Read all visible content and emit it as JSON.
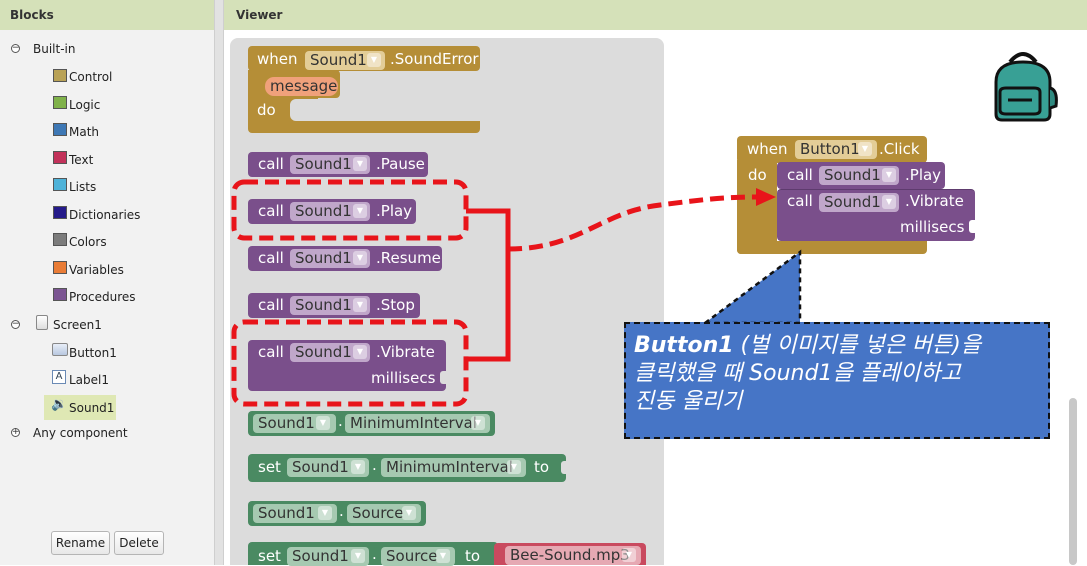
{
  "blocks_panel": {
    "title": "Blocks",
    "builtin_label": "Built-in",
    "builtin_items": [
      {
        "label": "Control",
        "color": "#b9a256"
      },
      {
        "label": "Logic",
        "color": "#80b24a"
      },
      {
        "label": "Math",
        "color": "#3e78b5"
      },
      {
        "label": "Text",
        "color": "#c2325a"
      },
      {
        "label": "Lists",
        "color": "#4eb2d8"
      },
      {
        "label": "Dictionaries",
        "color": "#251b8a"
      },
      {
        "label": "Colors",
        "color": "#7c7c7c"
      },
      {
        "label": "Variables",
        "color": "#e97c36"
      },
      {
        "label": "Procedures",
        "color": "#7b5592"
      }
    ],
    "screen_label": "Screen1",
    "components": [
      {
        "label": "Button1",
        "icon": "button-icon"
      },
      {
        "label": "Label1",
        "icon": "label-icon"
      },
      {
        "label": "Sound1",
        "icon": "sound-icon",
        "selected": true
      }
    ],
    "any_component_label": "Any component",
    "rename_label": "Rename",
    "delete_label": "Delete"
  },
  "viewer": {
    "title": "Viewer",
    "flyout_blocks": {
      "sound_error": {
        "when": "when",
        "component": "Sound1",
        "event": ".SoundError",
        "param": "message",
        "do": "do"
      },
      "pause": {
        "call": "call",
        "component": "Sound1",
        "method": ".Pause"
      },
      "play": {
        "call": "call",
        "component": "Sound1",
        "method": ".Play"
      },
      "resume": {
        "call": "call",
        "component": "Sound1",
        "method": ".Resume"
      },
      "stop": {
        "call": "call",
        "component": "Sound1",
        "method": ".Stop"
      },
      "vibrate": {
        "call": "call",
        "component": "Sound1",
        "method": ".Vibrate",
        "arg": "millisecs"
      },
      "min_interval_get": {
        "component": "Sound1",
        "dot": ".",
        "property": "MinimumInterval"
      },
      "min_interval_set": {
        "set": "set",
        "component": "Sound1",
        "dot": ".",
        "property": "MinimumInterval",
        "to": "to"
      },
      "source_get": {
        "component": "Sound1",
        "dot": ".",
        "property": "Source"
      },
      "source_set": {
        "set": "set",
        "component": "Sound1",
        "dot": ".",
        "property": "Source",
        "to": "to",
        "value": "Bee-Sound.mp3"
      }
    },
    "workspace_event": {
      "when": "when",
      "component": "Button1",
      "event": ".Click",
      "do": "do",
      "play_call": "call",
      "play_component": "Sound1",
      "play_method": ".Play",
      "vibrate_call": "call",
      "vibrate_component": "Sound1",
      "vibrate_method": ".Vibrate",
      "vibrate_arg": "millisecs"
    },
    "callout": {
      "bold": "Button1",
      "line1_rest": " (벌 이미지를 넣은 버튼)을",
      "line2": "클릭했을 때 Sound1을 플레이하고",
      "line3": "진동 울리기"
    },
    "colors": {
      "annotation_red": "#e8141a",
      "callout_blue": "#4675c6",
      "header_green": "#d5e1b9"
    }
  }
}
